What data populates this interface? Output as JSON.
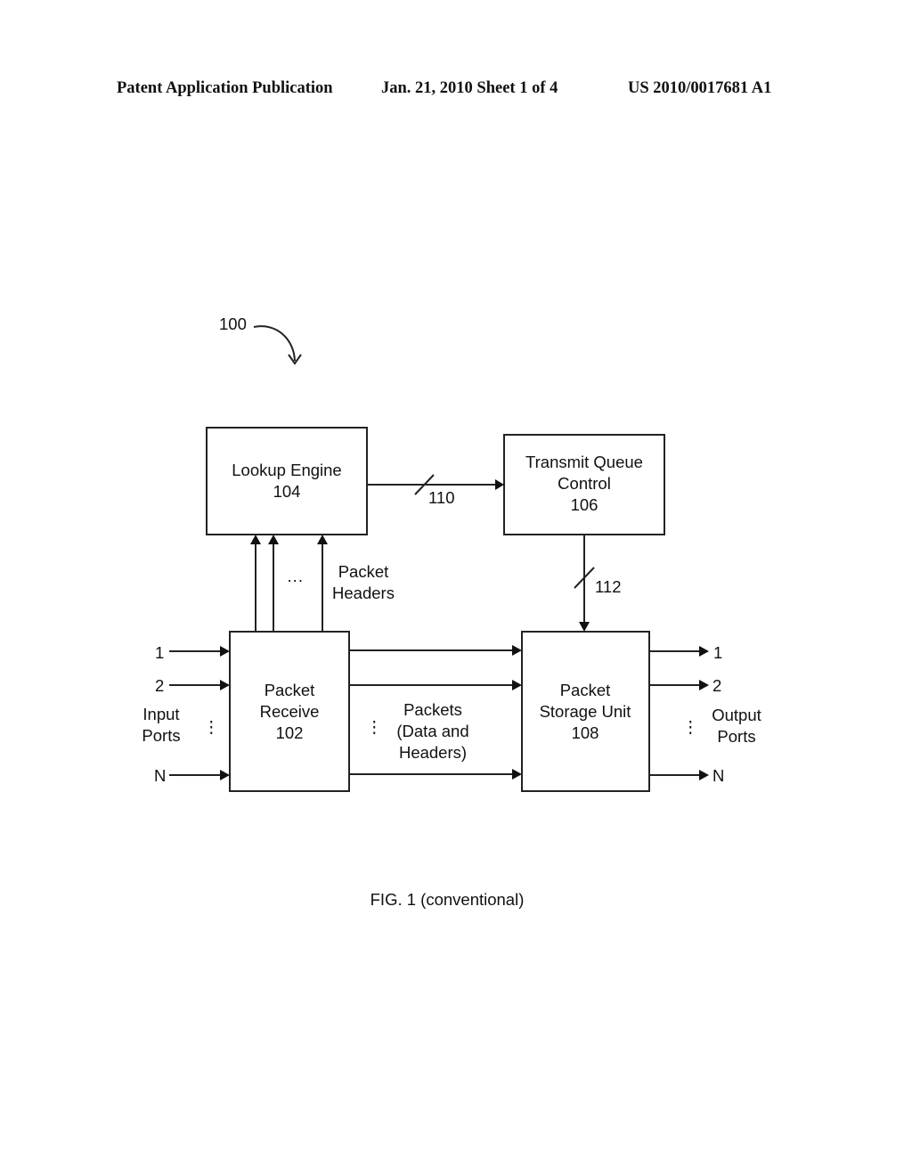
{
  "header": {
    "publication": "Patent Application Publication",
    "date_sheet": "Jan. 21, 2010  Sheet 1 of 4",
    "number": "US 2010/0017681 A1"
  },
  "figure": {
    "ref_system": "100",
    "caption": "FIG. 1 (conventional)",
    "blocks": {
      "lookup_engine": [
        "Lookup Engine",
        "104"
      ],
      "transmit_queue": [
        "Transmit Queue",
        "Control",
        "106"
      ],
      "packet_receive": [
        "Packet",
        "Receive",
        "102"
      ],
      "packet_storage": [
        "Packet",
        "Storage Unit",
        "108"
      ]
    },
    "buses": {
      "bus_110": "110",
      "bus_112": "112"
    },
    "labels": {
      "packet_headers": [
        "Packet",
        "Headers"
      ],
      "packets": [
        "Packets",
        "(Data and",
        "Headers)"
      ],
      "input_ports": [
        "Input",
        "Ports"
      ],
      "output_ports": [
        "Output",
        "Ports"
      ],
      "ellipsis_h": "···",
      "vdots": "⋮"
    },
    "input_port_ids": [
      "1",
      "2",
      "N"
    ],
    "output_port_ids": [
      "1",
      "2",
      "N"
    ]
  }
}
